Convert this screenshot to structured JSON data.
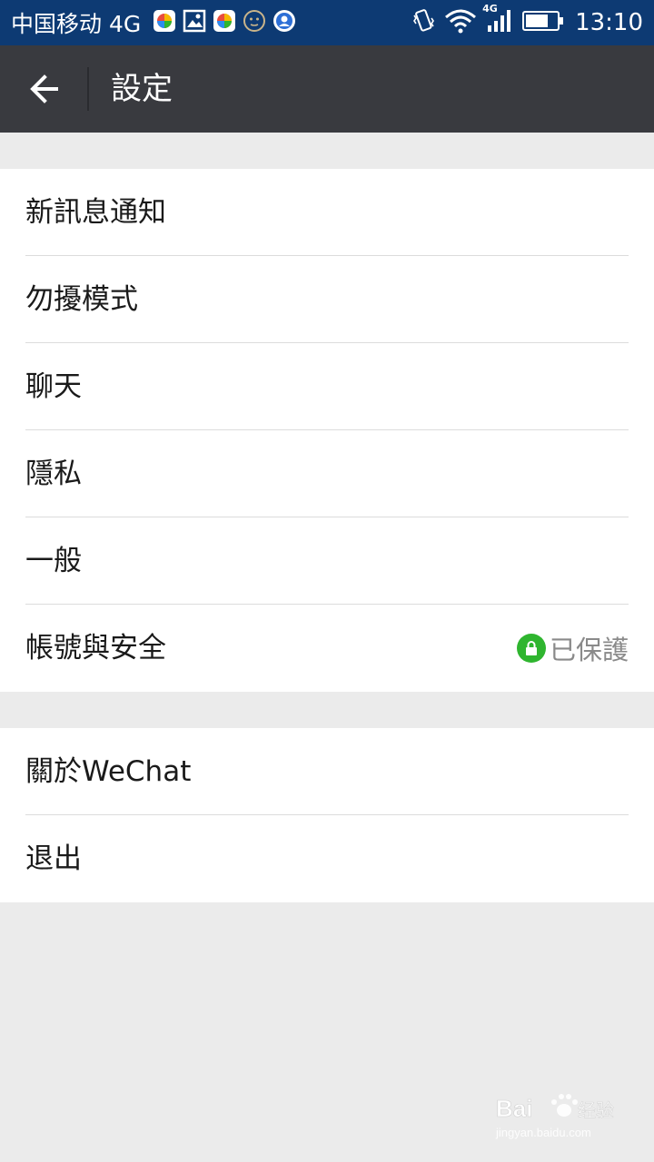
{
  "status_bar": {
    "carrier": "中国移动 4G",
    "network_badge": "4G",
    "time": "13:10",
    "icons": [
      "app-icon",
      "image-icon",
      "app-icon",
      "face-icon",
      "notification-icon",
      "vibrate-icon",
      "wifi-icon",
      "signal-icon",
      "battery-icon"
    ]
  },
  "app_bar": {
    "title": "設定",
    "back_icon": "arrow-left-icon"
  },
  "settings": {
    "group1": [
      {
        "label": "新訊息通知"
      },
      {
        "label": "勿擾模式"
      },
      {
        "label": "聊天"
      },
      {
        "label": "隱私"
      },
      {
        "label": "一般"
      },
      {
        "label": "帳號與安全",
        "status": "已保護",
        "status_icon": "lock-icon",
        "status_color": "#2fb52f"
      }
    ],
    "group2": [
      {
        "label": "關於WeChat"
      },
      {
        "label": "退出"
      }
    ]
  },
  "watermark": {
    "text": "Bai 经验",
    "url": "jingyan.baidu.com"
  },
  "colors": {
    "status_bar": "#0d3a73",
    "app_bar": "#393a3f",
    "background": "#ebebeb",
    "accent_green": "#2fb52f"
  }
}
